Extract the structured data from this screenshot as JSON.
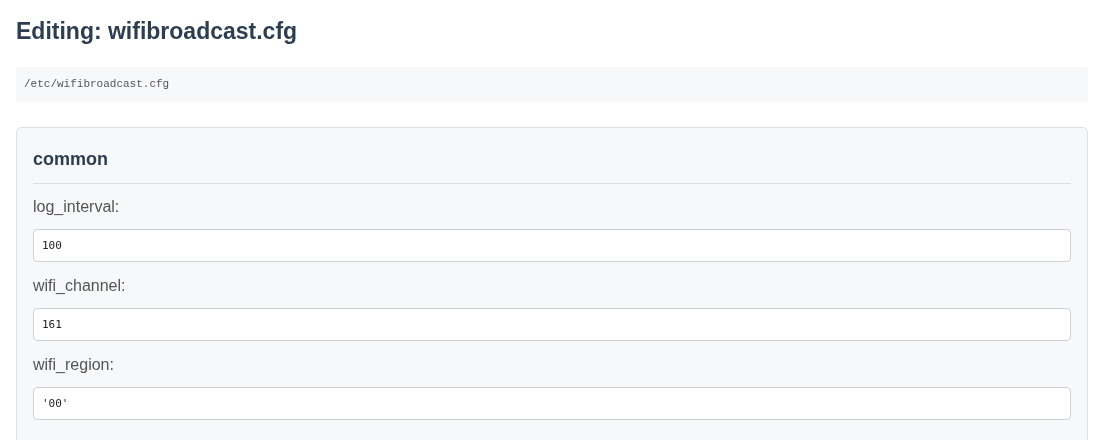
{
  "title": "Editing: wifibroadcast.cfg",
  "path": "/etc/wifibroadcast.cfg",
  "section": {
    "title": "common",
    "fields": [
      {
        "label": "log_interval:",
        "value": "100"
      },
      {
        "label": "wifi_channel:",
        "value": "161"
      },
      {
        "label": "wifi_region:",
        "value": "'00'"
      }
    ]
  }
}
